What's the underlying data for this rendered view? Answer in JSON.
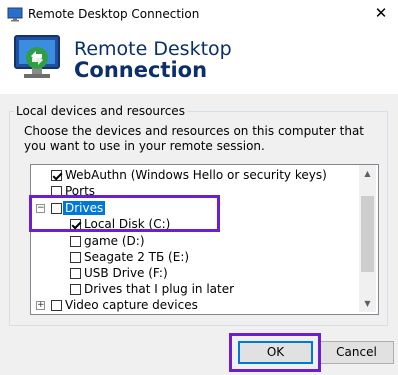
{
  "window": {
    "title": "Remote Desktop Connection",
    "close_glyph": "✕"
  },
  "header": {
    "line1": "Remote Desktop",
    "line2": "Connection"
  },
  "group": {
    "legend": "Local devices and resources",
    "description": "Choose the devices and resources on this computer that you want to use in your remote session."
  },
  "tree": {
    "items": [
      {
        "label": "WebAuthn (Windows Hello or security keys)",
        "checked": true
      },
      {
        "label": "Ports",
        "checked": false
      },
      {
        "label": "Drives",
        "checked": false,
        "expander": "−",
        "selected": true
      },
      {
        "label": "Local Disk (C:)",
        "checked": true
      },
      {
        "label": "game (D:)",
        "checked": false
      },
      {
        "label": "Seagate 2 ТБ (E:)",
        "checked": false
      },
      {
        "label": "USB Drive (F:)",
        "checked": false
      },
      {
        "label": "Drives that I plug in later",
        "checked": false
      },
      {
        "label": "Video capture devices",
        "checked": false,
        "expander": "+"
      }
    ]
  },
  "buttons": {
    "ok": "OK",
    "cancel": "Cancel"
  },
  "colors": {
    "highlight": "#0078d7",
    "annotation": "#6b1fd1",
    "header_text": "#0b2f6b"
  }
}
